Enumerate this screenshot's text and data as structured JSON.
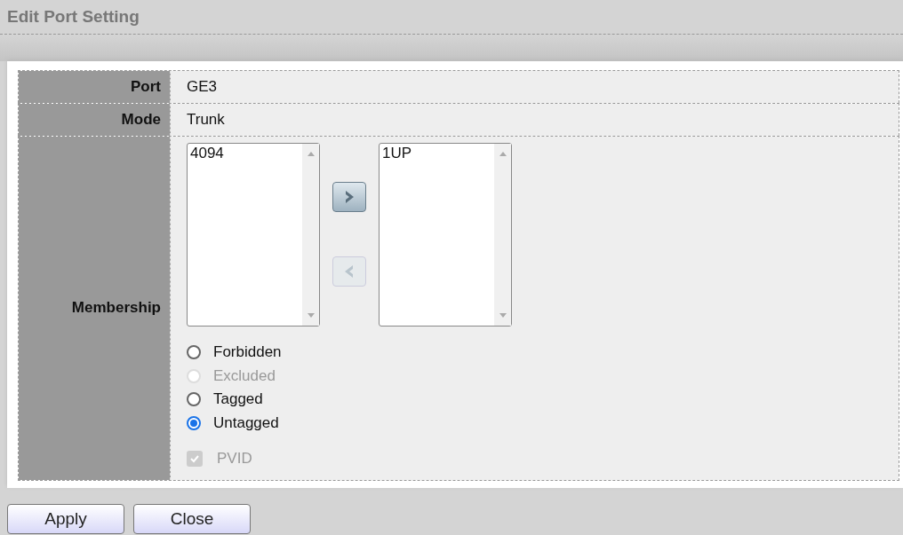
{
  "title": "Edit Port Setting",
  "fields": [
    {
      "label": "Port",
      "value": "GE3"
    },
    {
      "label": "Mode",
      "value": "Trunk"
    }
  ],
  "membership": {
    "label": "Membership",
    "available": {
      "items": [
        "4094"
      ]
    },
    "selected_list": {
      "items": [
        "1UP"
      ]
    },
    "move_buttons": [
      {
        "kind": "right",
        "disabled": false
      },
      {
        "kind": "left",
        "disabled": true
      }
    ],
    "options": [
      {
        "label": "Forbidden",
        "selected": false,
        "disabled": false
      },
      {
        "label": "Excluded",
        "selected": false,
        "disabled": true
      },
      {
        "label": "Tagged",
        "selected": false,
        "disabled": false
      },
      {
        "label": "Untagged",
        "selected": true,
        "disabled": false
      }
    ],
    "pvid": {
      "label": "PVID",
      "checked": true,
      "disabled": true
    }
  },
  "buttons": [
    "Apply",
    "Close"
  ]
}
